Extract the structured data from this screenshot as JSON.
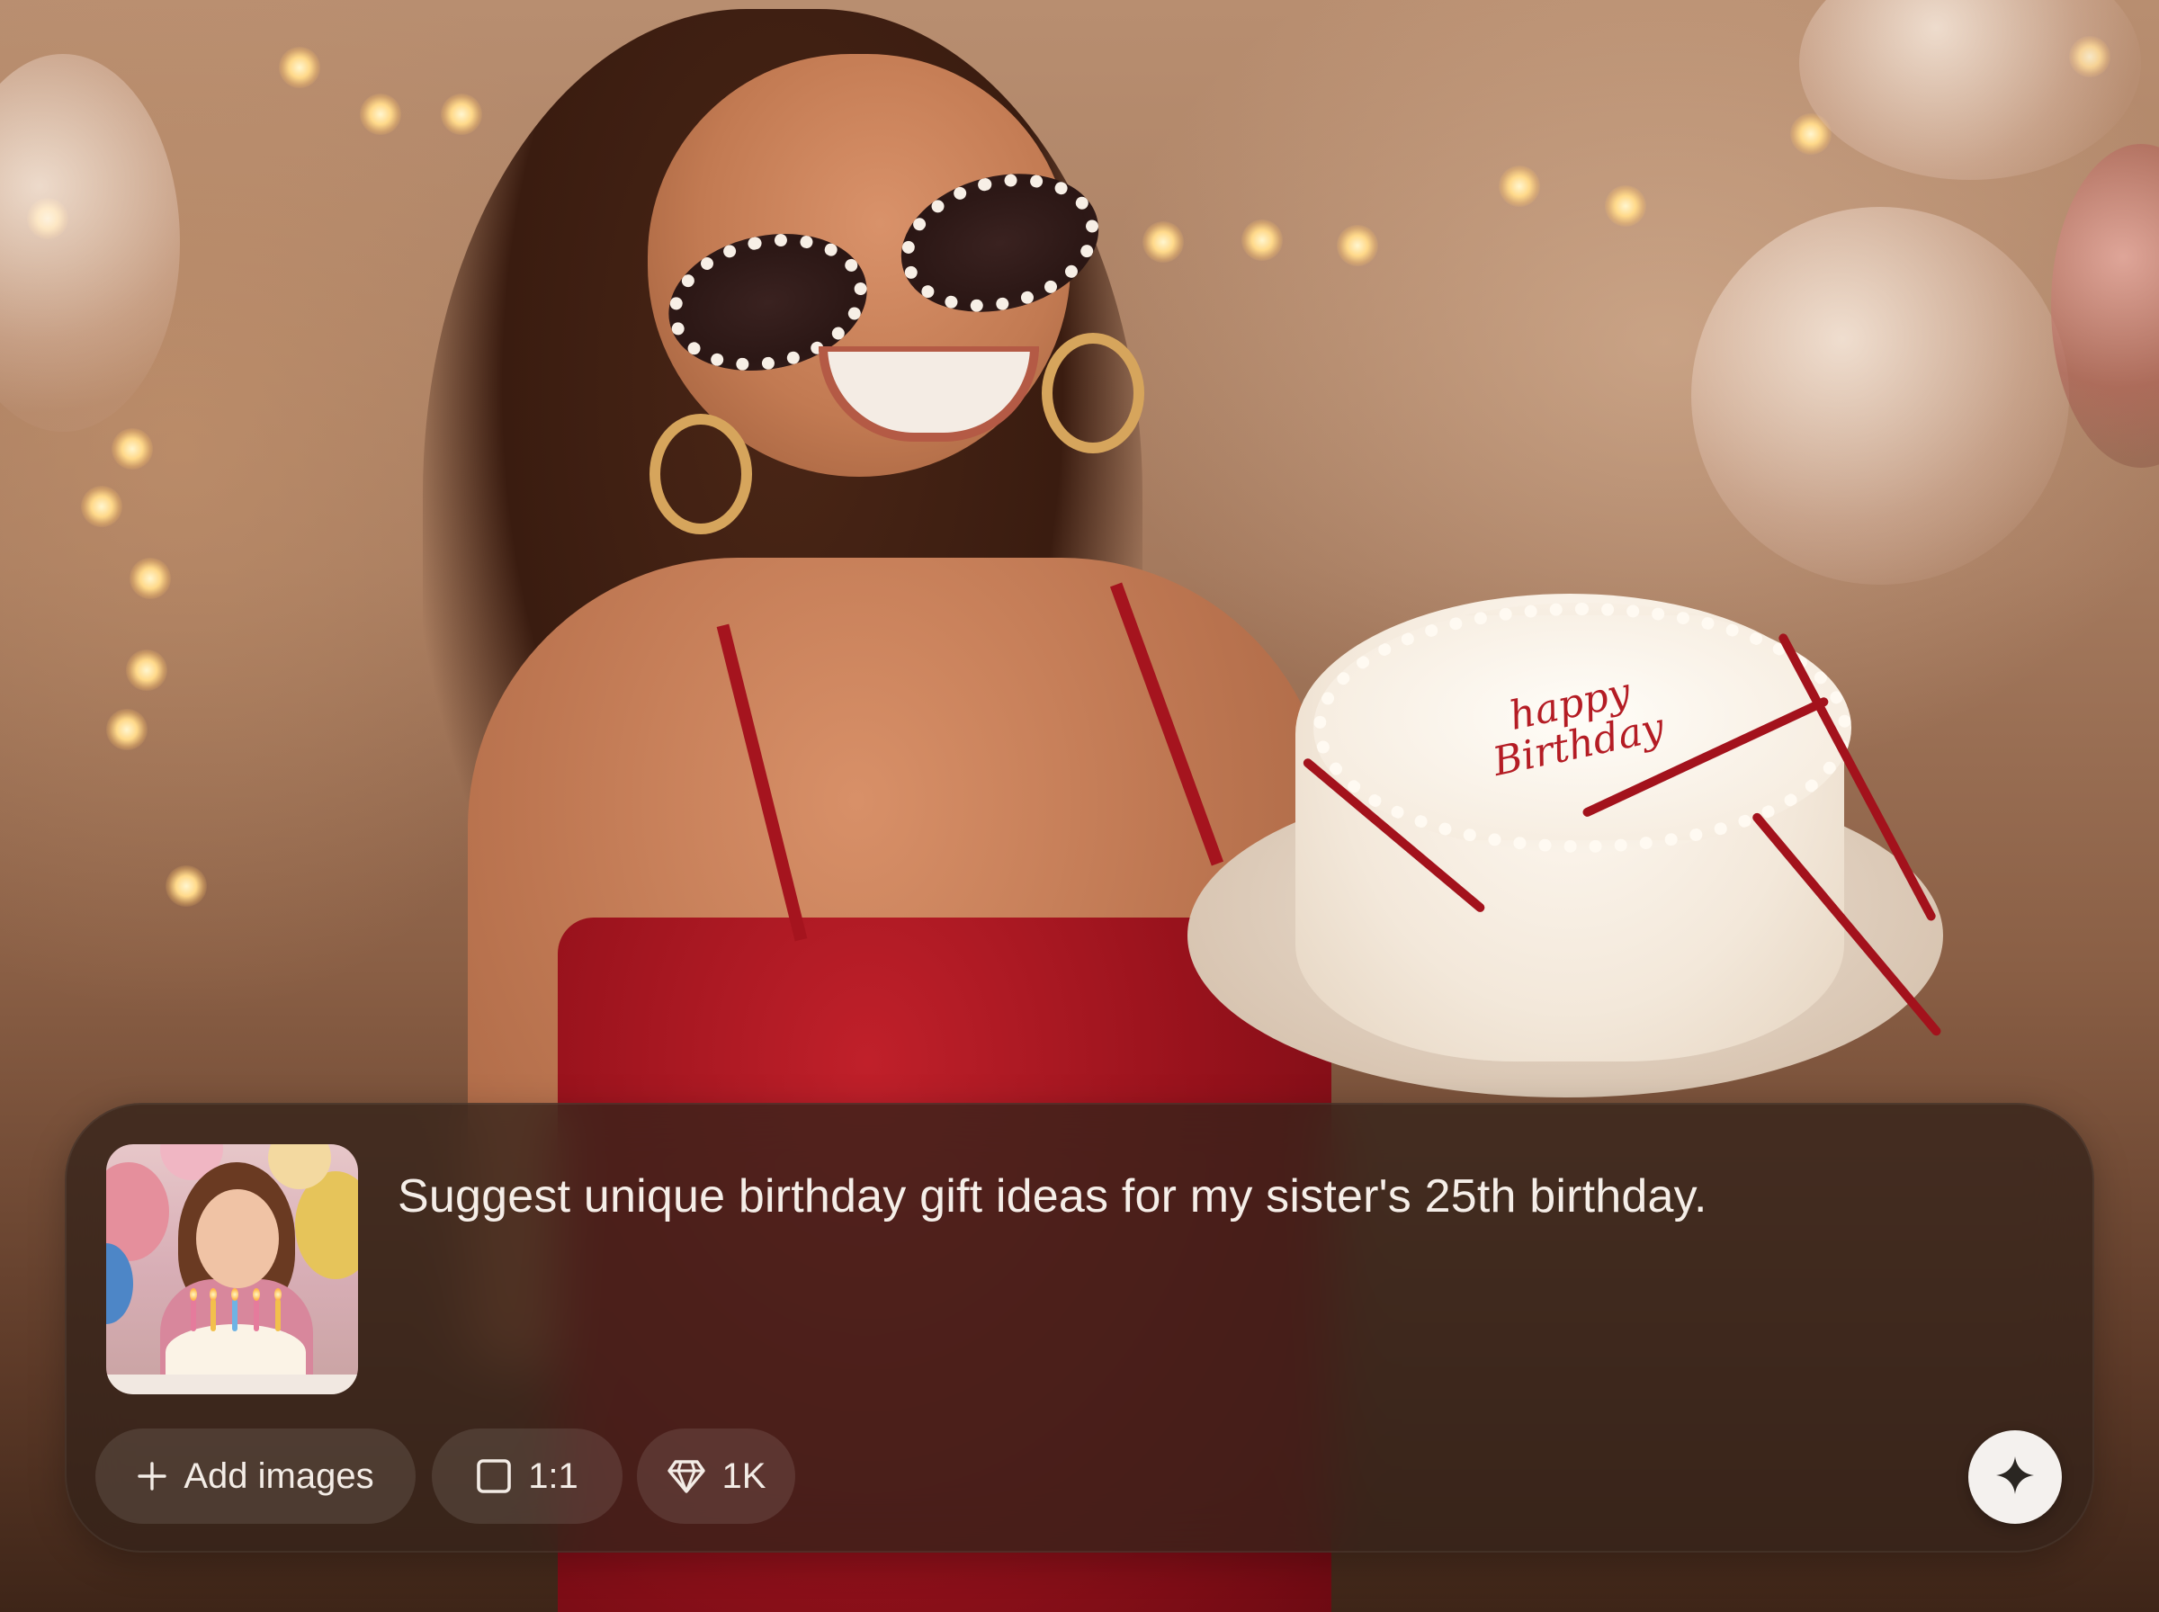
{
  "prompt": {
    "text": "Suggest unique birthday gift ideas for my sister's 25th birthday.",
    "attachment_icon": "birthday-girl-thumbnail"
  },
  "toolbar": {
    "add_images_label": "Add images",
    "add_images_icon": "plus-icon",
    "aspect_ratio_label": "1:1",
    "aspect_ratio_icon": "square-icon",
    "quality_label": "1K",
    "quality_icon": "diamond-icon",
    "send_icon": "sparkle-icon"
  },
  "background": {
    "cake_inscription_line1": "happy",
    "cake_inscription_line2": "Birthday"
  },
  "colors": {
    "panel": "#34221a",
    "chip": "#ffffff1a",
    "text": "#f5eee8",
    "send_button": "#f4f1ee",
    "send_icon": "#2a2622"
  }
}
